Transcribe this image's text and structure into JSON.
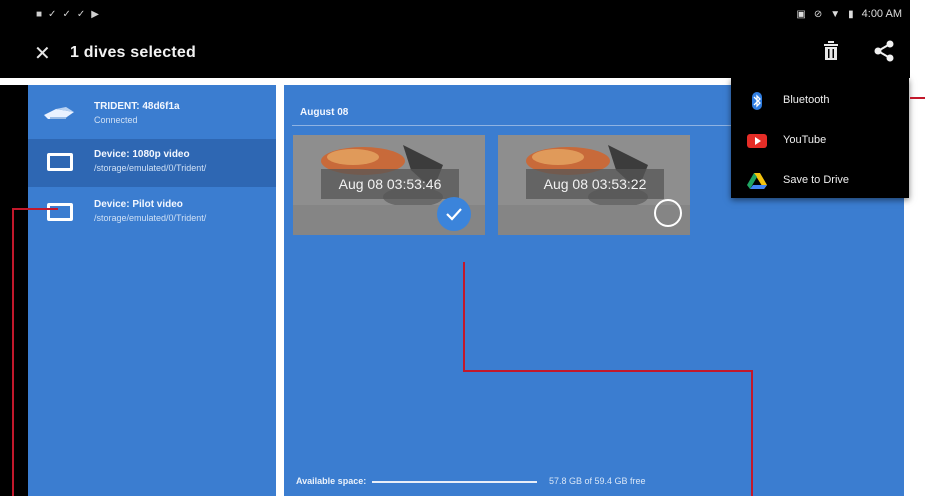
{
  "action_bar": {
    "close_icon": "close-icon",
    "title": "1 dives selected",
    "delete_icon": "trash-icon",
    "share_icon": "share-icon"
  },
  "status_bar": {
    "time": "4:00 AM"
  },
  "sidebar": {
    "items": [
      {
        "title": "TRIDENT: 48d6f1a",
        "subtitle": "Connected",
        "icon": "drone-icon"
      },
      {
        "title": "Device: 1080p video",
        "subtitle": "/storage/emulated/0/Trident/",
        "icon": "device-icon"
      },
      {
        "title": "Device: Pilot video",
        "subtitle": "/storage/emulated/0/Trident/",
        "icon": "device-icon"
      }
    ]
  },
  "main": {
    "section_date": "August 08",
    "thumbnails": [
      {
        "label": "Aug 08 03:53:46",
        "selected": true
      },
      {
        "label": "Aug 08 03:53:22",
        "selected": false
      }
    ],
    "available_label": "Available space:",
    "available_value": "57.8 GB of 59.4 GB free",
    "available_fraction": 0.973
  },
  "share_menu": {
    "items": [
      {
        "label": "Bluetooth",
        "icon": "bluetooth-icon"
      },
      {
        "label": "YouTube",
        "icon": "youtube-icon"
      },
      {
        "label": "Save to Drive",
        "icon": "drive-icon"
      }
    ]
  },
  "colors": {
    "panel_blue": "#3b7dd0",
    "selected_blue": "#2e67b3",
    "annotation_red": "#c2182b"
  }
}
